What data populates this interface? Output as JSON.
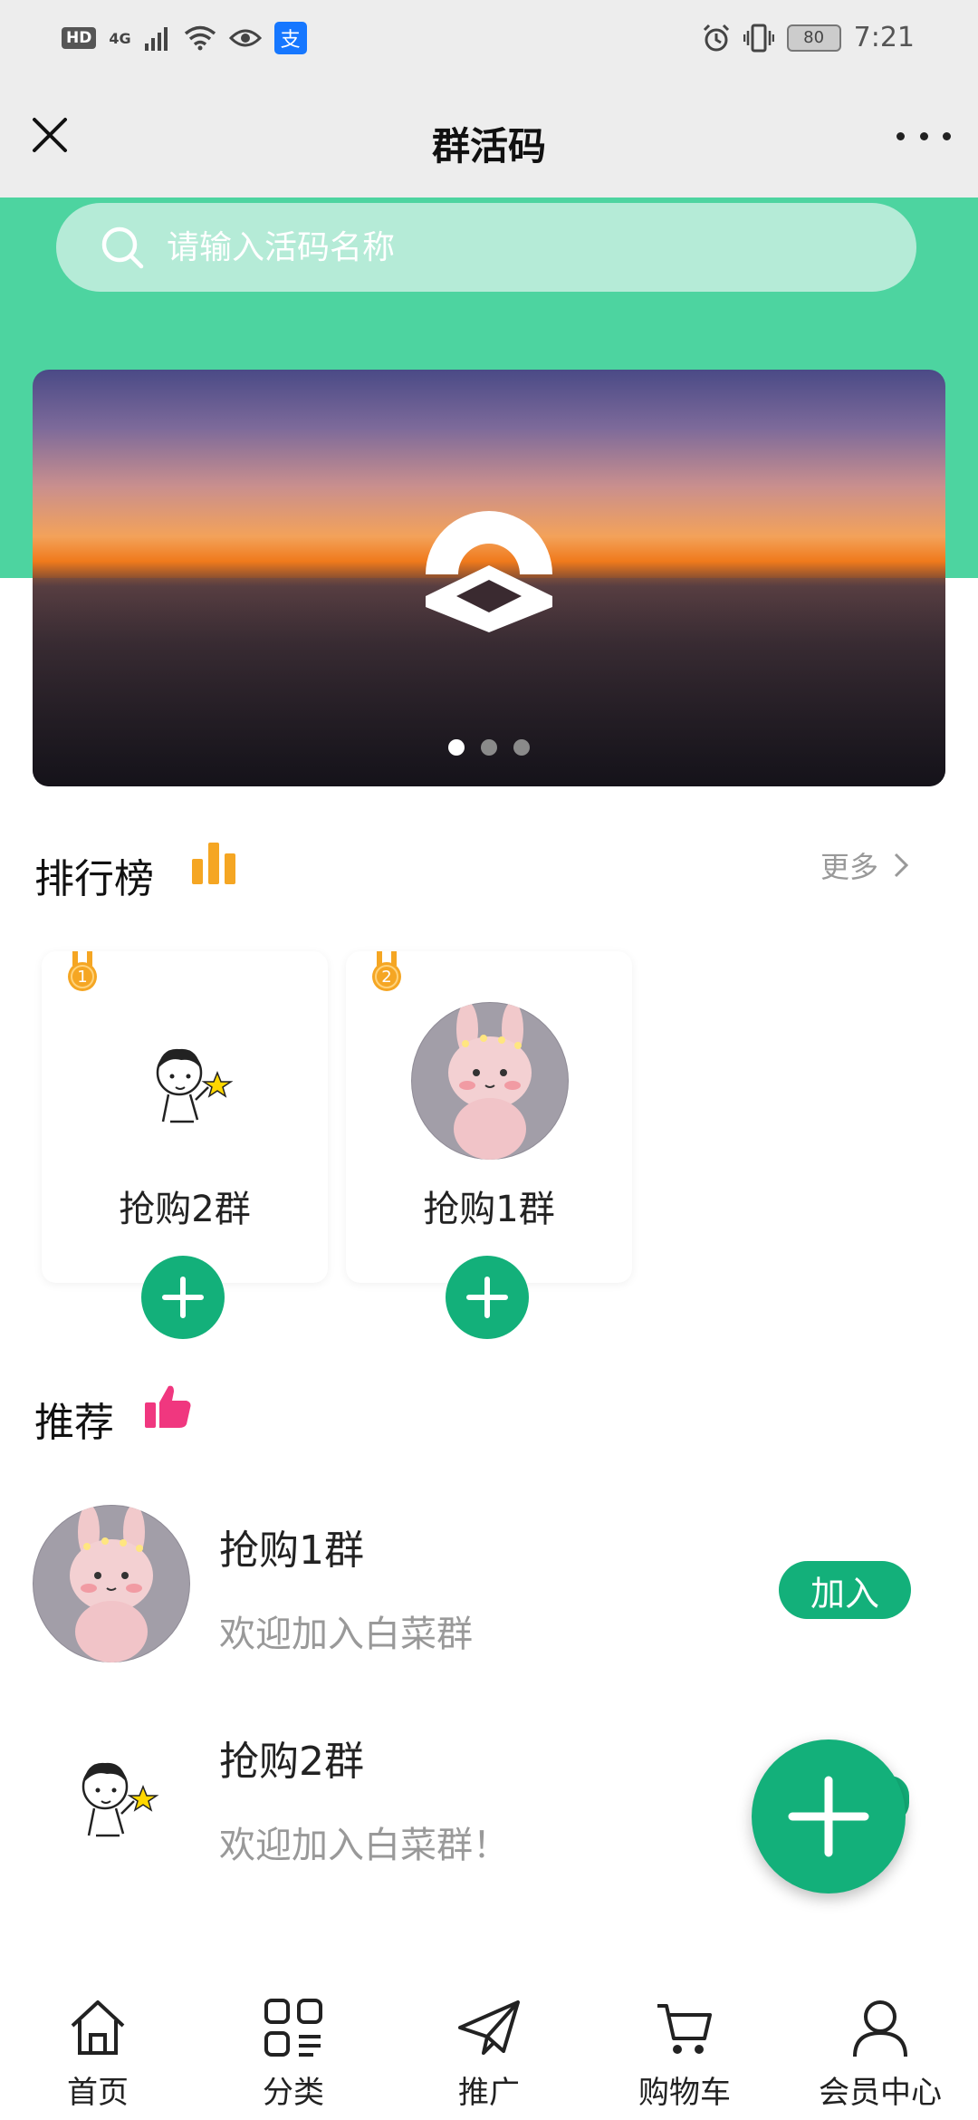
{
  "status_bar": {
    "hd": "HD",
    "network": "4G",
    "alipay_glyph": "支",
    "battery": "80",
    "time": "7:21",
    "icons": [
      "signal-icon",
      "wifi-icon",
      "eye-icon",
      "alipay-icon",
      "alarm-icon",
      "vibrate-icon",
      "battery-icon"
    ]
  },
  "header": {
    "title": "群活码"
  },
  "search": {
    "placeholder": "请输入活码名称"
  },
  "banner": {
    "dots": 3,
    "active_dot": 0
  },
  "ranking": {
    "title": "排行榜",
    "more": "更多",
    "cards": [
      {
        "rank": "1",
        "name": "抢购2群",
        "avatar": "boy-star-avatar"
      },
      {
        "rank": "2",
        "name": "抢购1群",
        "avatar": "pink-bunny-avatar"
      }
    ]
  },
  "recommend": {
    "title": "推荐",
    "items": [
      {
        "name": "抢购1群",
        "desc": "欢迎加入白菜群",
        "avatar": "pink-bunny-avatar",
        "join": "加入"
      },
      {
        "name": "抢购2群",
        "desc": "欢迎加入白菜群！",
        "avatar": "boy-star-avatar"
      }
    ]
  },
  "nav": [
    {
      "label": "首页",
      "icon": "home-icon"
    },
    {
      "label": "分类",
      "icon": "category-icon"
    },
    {
      "label": "推广",
      "icon": "paper-plane-icon"
    },
    {
      "label": "购物车",
      "icon": "cart-icon"
    },
    {
      "label": "会员中心",
      "icon": "user-icon"
    }
  ],
  "colors": {
    "accent": "#13b07a",
    "header_green": "#4dd4a0",
    "medal": "#f5a623",
    "thumb": "#f0377f"
  }
}
